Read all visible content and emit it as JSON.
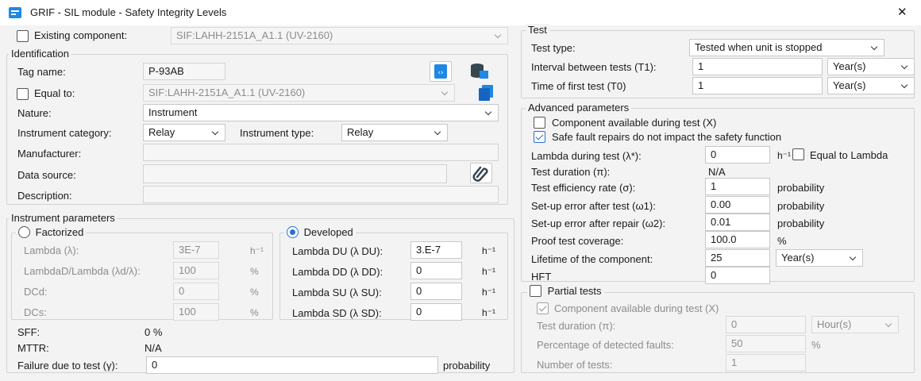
{
  "window": {
    "title": "GRIF - SIL module - Safety Integrity Levels",
    "close_glyph": "✕"
  },
  "existing": {
    "label": "Existing component:",
    "value": "SIF:LAHH-2151A_A1.1 (UV-2160)"
  },
  "identification": {
    "title": "Identification",
    "tag_label": "Tag name:",
    "tag_value": "P-93AB",
    "equal_label": "Equal to:",
    "equal_value": "SIF:LAHH-2151A_A1.1 (UV-2160)",
    "nature_label": "Nature:",
    "nature_value": "Instrument",
    "category_label": "Instrument category:",
    "category_value": "Relay",
    "type_label": "Instrument type:",
    "type_value": "Relay",
    "manufacturer_label": "Manufacturer:",
    "manufacturer_value": "",
    "source_label": "Data source:",
    "source_value": "",
    "description_label": "Description:",
    "description_value": ""
  },
  "instrument": {
    "title": "Instrument parameters",
    "factorized": {
      "title": "Factorized",
      "rows": [
        {
          "label": "Lambda (λ):",
          "value": "3E-7",
          "unit": "h⁻¹"
        },
        {
          "label": "LambdaD/Lambda (λd/λ):",
          "value": "100",
          "unit": "%"
        },
        {
          "label": "DCd:",
          "value": "0",
          "unit": "%"
        },
        {
          "label": "DCs:",
          "value": "100",
          "unit": "%"
        }
      ]
    },
    "developed": {
      "title": "Developed",
      "rows": [
        {
          "label": "Lambda DU (λ DU):",
          "value": "3.E-7",
          "unit": "h⁻¹"
        },
        {
          "label": "Lambda DD (λ DD):",
          "value": "0",
          "unit": "h⁻¹"
        },
        {
          "label": "Lambda SU (λ SU):",
          "value": "0",
          "unit": "h⁻¹"
        },
        {
          "label": "Lambda SD (λ SD):",
          "value": "0",
          "unit": "h⁻¹"
        }
      ]
    },
    "sff_label": "SFF:",
    "sff_value": "0 %",
    "mttr_label": "MTTR:",
    "mttr_value": "N/A",
    "failure_label": "Failure due to test (γ):",
    "failure_value": "0",
    "failure_unit": "probability"
  },
  "test": {
    "title": "Test",
    "type_label": "Test type:",
    "type_value": "Tested when unit is stopped",
    "interval_label": "Interval between tests (T1):",
    "interval_value": "1",
    "interval_unit": "Year(s)",
    "first_label": "Time of first test (T0)",
    "first_value": "1",
    "first_unit": "Year(s)"
  },
  "advanced": {
    "title": "Advanced parameters",
    "available_label": "Component available during test (X)",
    "safe_label": "Safe fault repairs do not impact the safety function",
    "lambda_label": "Lambda during test (λ*):",
    "lambda_value": "0",
    "lambda_unit": "h⁻¹",
    "equal_lambda_label": "Equal to Lambda",
    "duration_label": "Test duration (π):",
    "duration_value": "N/A",
    "efficiency_label": "Test efficiency rate (σ):",
    "efficiency_value": "1",
    "efficiency_unit": "probability",
    "setup_test_label": "Set-up error after test (ω1):",
    "setup_test_value": "0.00",
    "setup_test_unit": "probability",
    "setup_repair_label": "Set-up error after repair (ω2):",
    "setup_repair_value": "0.01",
    "setup_repair_unit": "probability",
    "coverage_label": "Proof test coverage:",
    "coverage_value": "100.0",
    "coverage_unit": "%",
    "lifetime_label": "Lifetime of the component:",
    "lifetime_value": "25",
    "lifetime_unit": "Year(s)",
    "hft_label": "HFT",
    "hft_value": "0"
  },
  "partial": {
    "title": "Partial tests",
    "available_label": "Component available during test (X)",
    "duration_label": "Test duration (π):",
    "duration_value": "0",
    "duration_unit": "Hour(s)",
    "percent_label": "Percentage of detected faults:",
    "percent_value": "50",
    "percent_unit": "%",
    "number_label": "Number of tests:",
    "number_value": "1"
  },
  "colors": {
    "accent": "#2a6fd6",
    "icon_blue": "#1e88e5",
    "icon_dark": "#37474f"
  }
}
